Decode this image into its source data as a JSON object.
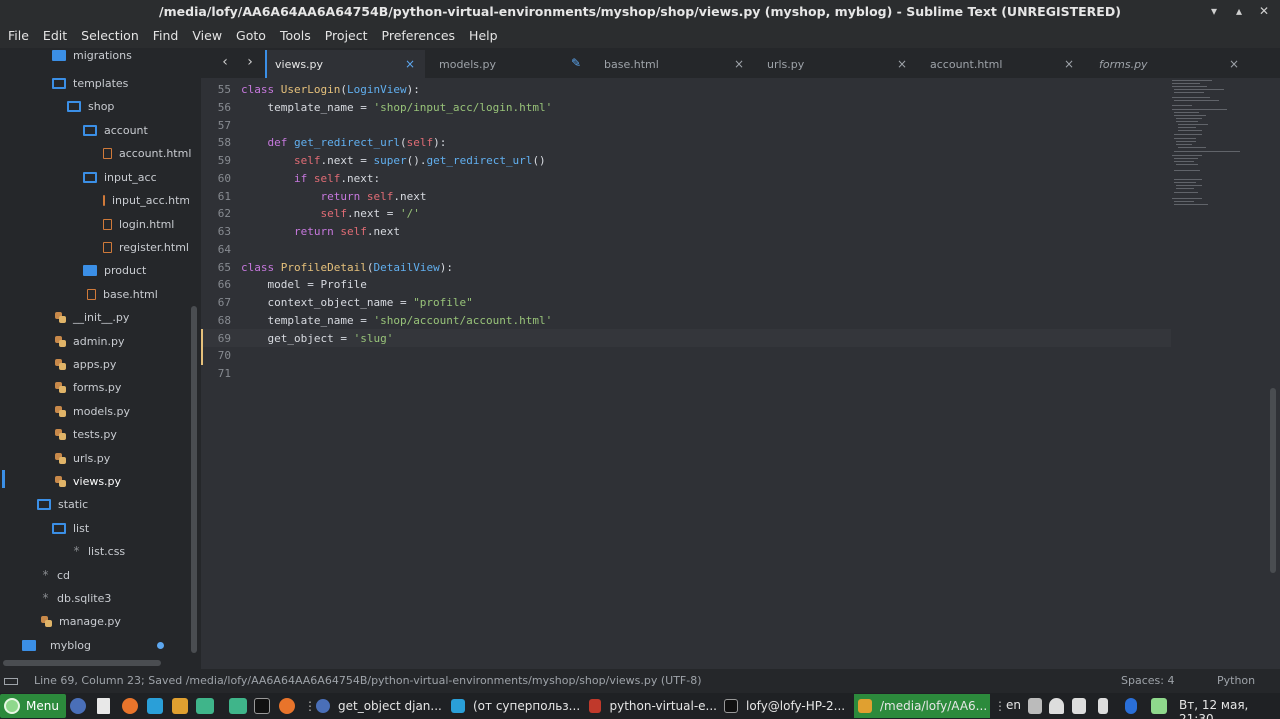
{
  "window": {
    "title": "/media/lofy/AA6A64AA6A64754B/python-virtual-environments/myshop/shop/views.py (myshop, myblog) - Sublime Text (UNREGISTERED)",
    "minimize": "▾",
    "maximize": "▴",
    "close": "✕"
  },
  "menu": [
    "File",
    "Edit",
    "Selection",
    "Find",
    "View",
    "Goto",
    "Tools",
    "Project",
    "Preferences",
    "Help"
  ],
  "sidebar": {
    "items": [
      {
        "label": "migrations",
        "icon": "folder-filled-icon"
      },
      {
        "label": "templates",
        "icon": "folder-open-icon"
      },
      {
        "label": "shop",
        "icon": "folder-open-icon"
      },
      {
        "label": "account",
        "icon": "folder-open-icon"
      },
      {
        "label": "account.html",
        "icon": "html-file-icon"
      },
      {
        "label": "input_acc",
        "icon": "folder-open-icon"
      },
      {
        "label": "input_acc.htm",
        "icon": "html-file-icon"
      },
      {
        "label": "login.html",
        "icon": "html-file-icon"
      },
      {
        "label": "register.html",
        "icon": "html-file-icon"
      },
      {
        "label": "product",
        "icon": "folder-filled-icon"
      },
      {
        "label": "base.html",
        "icon": "html-file-icon"
      },
      {
        "label": "__init__.py",
        "icon": "python-file-icon"
      },
      {
        "label": "admin.py",
        "icon": "python-file-icon"
      },
      {
        "label": "apps.py",
        "icon": "python-file-icon"
      },
      {
        "label": "forms.py",
        "icon": "python-file-icon"
      },
      {
        "label": "models.py",
        "icon": "python-file-icon"
      },
      {
        "label": "tests.py",
        "icon": "python-file-icon"
      },
      {
        "label": "urls.py",
        "icon": "python-file-icon"
      },
      {
        "label": "views.py",
        "icon": "python-file-icon"
      },
      {
        "label": "static",
        "icon": "folder-open-icon"
      },
      {
        "label": "list",
        "icon": "folder-open-icon"
      },
      {
        "label": "list.css",
        "icon": "generic-file-icon"
      },
      {
        "label": "cd",
        "icon": "generic-file-icon"
      },
      {
        "label": "db.sqlite3",
        "icon": "generic-file-icon"
      },
      {
        "label": "manage.py",
        "icon": "python-file-icon"
      },
      {
        "label": "myblog",
        "icon": "folder-filled-icon"
      }
    ]
  },
  "tabs": [
    {
      "label": "views.py",
      "active": true
    },
    {
      "label": "models.py",
      "modified": true
    },
    {
      "label": "base.html"
    },
    {
      "label": "urls.py"
    },
    {
      "label": "account.html"
    },
    {
      "label": "forms.py",
      "italic": true
    }
  ],
  "tab_close": "×",
  "tab_modified": "✎",
  "nav": {
    "back": "‹",
    "forward": "›"
  },
  "code": {
    "line_numbers": [
      "55",
      "56",
      "57",
      "58",
      "59",
      "60",
      "61",
      "62",
      "63",
      "64",
      "65",
      "66",
      "67",
      "68",
      "69",
      "70",
      "71"
    ],
    "lines": [
      "class UserLogin(LoginView):",
      "    template_name = 'shop/input_acc/login.html'",
      "",
      "    def get_redirect_url(self):",
      "        self.next = super().get_redirect_url()",
      "        if self.next:",
      "            return self.next",
      "            self.next = '/'",
      "        return self.next",
      "",
      "class ProfileDetail(DetailView):",
      "    model = Profile",
      "    context_object_name = \"profile\"",
      "    template_name = 'shop/account/account.html'",
      "    get_object = 'slug'",
      "",
      ""
    ]
  },
  "status": {
    "left": "Line 69, Column 23; Saved /media/lofy/AA6A64AA6A64754B/python-virtual-environments/myshop/shop/views.py (UTF-8)",
    "spaces": "Spaces: 4",
    "syntax": "Python"
  },
  "taskbar": {
    "menu_label": "Menu",
    "windows": [
      {
        "label": "get_object djan..."
      },
      {
        "label": "(от суперпольз..."
      },
      {
        "label": "python-virtual-e..."
      },
      {
        "label": "lofy@lofy-HP-2..."
      },
      {
        "label": "/media/lofy/AA6...",
        "active": true
      }
    ],
    "lang": "en",
    "clock": "Вт, 12 мая, 21:30"
  },
  "colors": {
    "accent": "#3b8fe6",
    "taskbar_active": "#2c8a3c",
    "editor_bg": "#2f3136"
  }
}
